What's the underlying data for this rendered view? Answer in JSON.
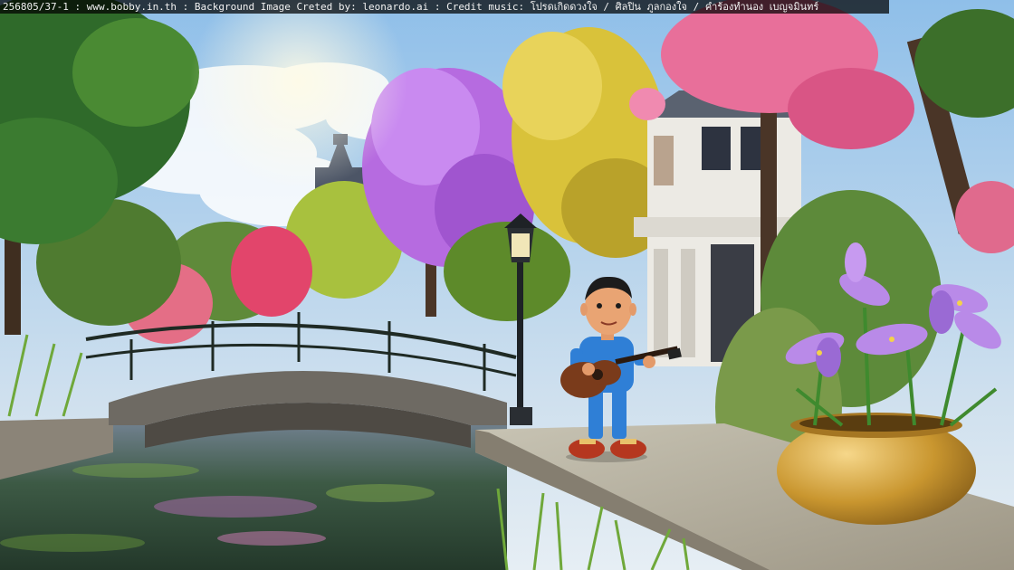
{
  "caption": {
    "text": "256805/37-1 : www.bobby.in.th : Background Image Creted by: leonardo.ai : Credit music: โปรดเกิดดวงใจ / ศิลปิน ภูลกองใจ / คำร้องทำนอง เบญจมินทร์"
  },
  "colors": {
    "sky_top": "#8fbfe9",
    "sky_bottom": "#e6eef4",
    "purple_tree": "#b66be0",
    "pink_tree": "#e95b8a",
    "yellow_tree": "#d9c23a",
    "water": "#3d5a45",
    "pot_gold": "#c9962f",
    "iris_petal": "#b98ae8",
    "character_shirt": "#2f7fd6",
    "guitar_body": "#7a3b1b"
  },
  "scene": {
    "description_icons": [
      "canal",
      "stone-bridge",
      "street-lamp",
      "white-house",
      "church-spire",
      "guitarist-character",
      "golden-flower-pot",
      "iris-flowers"
    ]
  }
}
